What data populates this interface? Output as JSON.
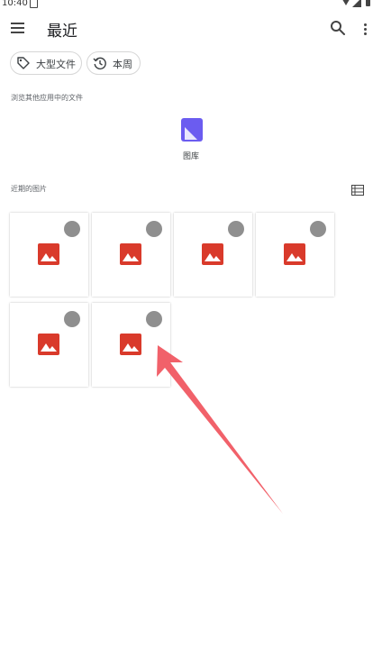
{
  "status_bar": {
    "time": "10:40",
    "icons": [
      "sim-card-icon",
      "wifi-icon",
      "signal-icon",
      "battery-icon"
    ]
  },
  "app_bar": {
    "title": "最近",
    "icons": [
      "menu-icon",
      "search-icon",
      "more-vert-icon"
    ]
  },
  "chips": [
    {
      "label": "大型文件",
      "icon": "tag-icon"
    },
    {
      "label": "本周",
      "icon": "history-icon"
    }
  ],
  "sources": {
    "heading": "浏览其他应用中的文件",
    "items": [
      {
        "label": "图库",
        "icon": "gallery-app-icon",
        "color": "#6b5cf0"
      }
    ]
  },
  "recent": {
    "heading": "近期的图片",
    "view_toggle_icon": "list-view-icon",
    "items": [
      {
        "type": "image",
        "icon": "image-file-icon"
      },
      {
        "type": "image",
        "icon": "image-file-icon"
      },
      {
        "type": "image",
        "icon": "image-file-icon"
      },
      {
        "type": "image",
        "icon": "image-file-icon"
      },
      {
        "type": "image",
        "icon": "image-file-icon"
      },
      {
        "type": "image",
        "icon": "image-file-icon"
      }
    ]
  },
  "colors": {
    "image_icon": "#d93a2b",
    "gallery_app": "#6b5cf0",
    "annotation_arrow": "#f0505a",
    "select_circle": "#8f8f8f"
  }
}
